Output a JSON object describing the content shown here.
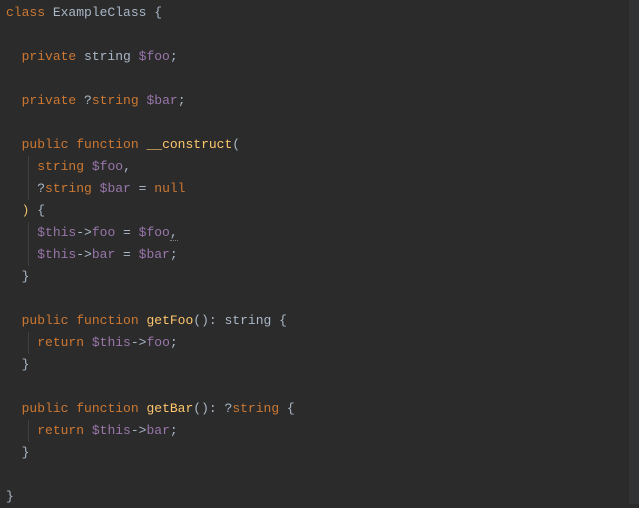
{
  "code": {
    "l1_class": "class",
    "l1_name": "ExampleClass",
    "l1_brace": " {",
    "l3_private": "private",
    "l3_type": "string",
    "l3_var": "$foo",
    "l3_semi": ";",
    "l5_private": "private",
    "l5_q": "?",
    "l5_type": "string",
    "l5_var": "$bar",
    "l5_semi": ";",
    "l7_public": "public",
    "l7_function": "function",
    "l7_name": "__construct",
    "l7_paren": "(",
    "l8_type": "string",
    "l8_var": "$foo",
    "l8_comma": ",",
    "l9_q": "?",
    "l9_type": "string",
    "l9_var": "$bar",
    "l9_eq": " = ",
    "l9_null": "null",
    "l10_close": ")",
    "l10_brace": " {",
    "l11_this": "$this",
    "l11_arrow": "->",
    "l11_prop": "foo",
    "l11_eq": " = ",
    "l11_var": "$foo",
    "l11_semi": ",",
    "l12_this": "$this",
    "l12_arrow": "->",
    "l12_prop": "bar",
    "l12_eq": " = ",
    "l12_var": "$bar",
    "l12_semi": ";",
    "l13_brace": "}",
    "l15_public": "public",
    "l15_function": "function",
    "l15_name": "getFoo",
    "l15_parens": "()",
    "l15_colon": ": ",
    "l15_type": "string",
    "l15_brace": " {",
    "l16_return": "return",
    "l16_this": "$this",
    "l16_arrow": "->",
    "l16_prop": "foo",
    "l16_semi": ";",
    "l17_brace": "}",
    "l19_public": "public",
    "l19_function": "function",
    "l19_name": "getBar",
    "l19_parens": "()",
    "l19_colon": ": ",
    "l19_q": "?",
    "l19_type": "string",
    "l19_brace": " {",
    "l20_return": "return",
    "l20_this": "$this",
    "l20_arrow": "->",
    "l20_prop": "bar",
    "l20_semi": ";",
    "l21_brace": "}",
    "l23_brace": "}"
  },
  "indent1": "  ",
  "indent2": "    ",
  "sp": " "
}
